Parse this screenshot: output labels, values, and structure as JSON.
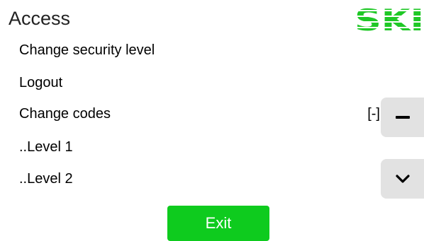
{
  "header": {
    "title": "Access",
    "logo_icon": "ski-logo-icon",
    "logo_color": "#1fc826"
  },
  "menu": {
    "items": [
      {
        "label": "Change security level"
      },
      {
        "label": "Logout"
      },
      {
        "label": "Change codes",
        "value": "[-]"
      },
      {
        "label": "..Level 1"
      },
      {
        "label": "..Level 2"
      }
    ]
  },
  "side_buttons": {
    "collapse_icon": "minus-icon",
    "scroll_down_icon": "chevron-down-icon",
    "background": "#e2e2e2"
  },
  "footer": {
    "exit_label": "Exit",
    "exit_color": "#0ecb1e"
  }
}
